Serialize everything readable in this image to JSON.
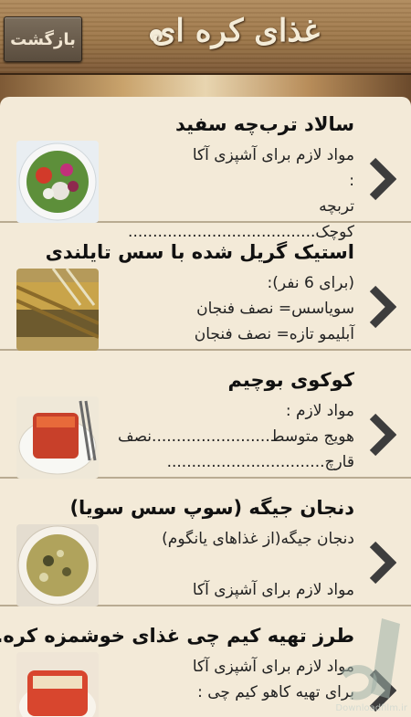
{
  "header": {
    "title": "غذای کره ای",
    "back_label": "بازگشت"
  },
  "items": [
    {
      "title": "سالاد ترب‌چه سفید",
      "text": "مواد لازم برای آشپزی آکا\n:\nتربچه کوچک......................................"
    },
    {
      "title": "استیک گریل شده با سس تایلندی",
      "text": "(برای 6 نفر):\nسویاسس= نصف فنجان\nآبلیمو تازه= نصف فنجان"
    },
    {
      "title": "کوکوی بوچیم",
      "text": "مواد لازم :\nهویج متوسط........................نصف\nقارچ................................"
    },
    {
      "title": "دنجان جیگه (سوپ سس سویا)",
      "text": "دنجان جیگه(از غذاهای یانگوم)\n\nمواد لازم برای آشپزی آکا"
    },
    {
      "title": "طرز تهیه کیم چی غذای خوشمزه کره...",
      "text": "مواد لازم برای آشپزی آکا\nبرای تهیه کاهو کیم چی :"
    }
  ],
  "watermark": "Downloadfilm.ir",
  "colors": {
    "panel": "#f3ead8",
    "divider": "#b9ab92",
    "chevron": "#3d3d3d",
    "header_wood": "#9c7648"
  },
  "icons": {
    "row_arrow": "chevron-right-icon",
    "back": "back-button"
  }
}
